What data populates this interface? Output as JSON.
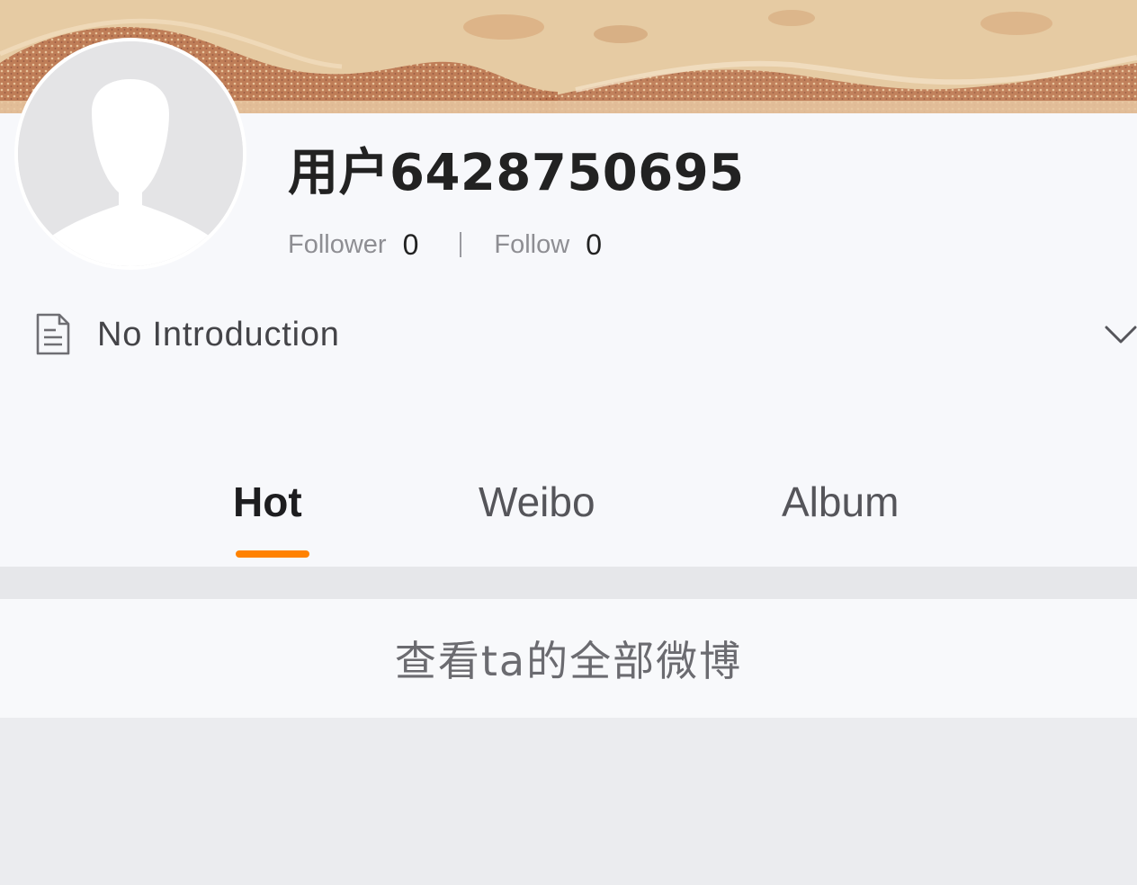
{
  "profile": {
    "username": "用户6428750695",
    "followers": {
      "label": "Follower",
      "count": "0"
    },
    "following": {
      "label": "Follow",
      "count": "0"
    },
    "introduction": "No Introduction"
  },
  "tabs": [
    {
      "label": "Hot",
      "active": true
    },
    {
      "label": "Weibo",
      "active": false
    },
    {
      "label": "Album",
      "active": false
    }
  ],
  "view_all_label": "查看ta的全部微博",
  "colors": {
    "tab_indicator": "#ff8200",
    "background": "#f7f8fb",
    "text_primary": "#222222",
    "text_secondary": "#8e8e93"
  },
  "icons": {
    "avatar": "default-avatar-silhouette",
    "intro": "document-icon",
    "expand": "chevron-down-icon"
  }
}
